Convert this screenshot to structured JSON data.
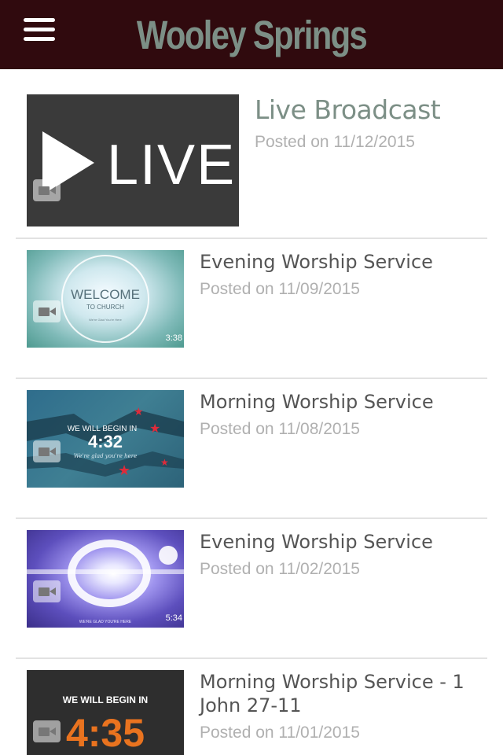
{
  "header": {
    "title": "Wooley Springs",
    "background": "#300a0e",
    "title_color": "#7c8f86"
  },
  "items": [
    {
      "title": "Live Broadcast",
      "date": "Posted on 11/12/2015",
      "thumb_text": "LIVE",
      "icon": "video-camera-icon"
    },
    {
      "title": "Evening Worship Service",
      "date": "Posted on 11/09/2015",
      "thumb_text": "WELCOME",
      "thumb_sub": "TO CHURCH",
      "thumb_small": "We're Glad You're Here",
      "duration": "3:38",
      "icon": "video-camera-icon"
    },
    {
      "title": "Morning Worship Service",
      "date": "Posted on 11/08/2015",
      "thumb_text": "WE WILL BEGIN IN",
      "thumb_time": "4:32",
      "thumb_small": "We're glad you're here",
      "icon": "video-camera-icon"
    },
    {
      "title": "Evening Worship Service",
      "date": "Posted on 11/02/2015",
      "duration": "5:34",
      "thumb_small": "WE'RE GLAD YOU'RE HERE",
      "icon": "video-camera-icon"
    },
    {
      "title_line1": "Morning Worship Service - 1",
      "title_line2": "John 27-11",
      "date": "Posted on 11/01/2015",
      "thumb_text": "WE WILL BEGIN IN",
      "thumb_time": "4:35",
      "icon": "video-camera-icon"
    }
  ]
}
